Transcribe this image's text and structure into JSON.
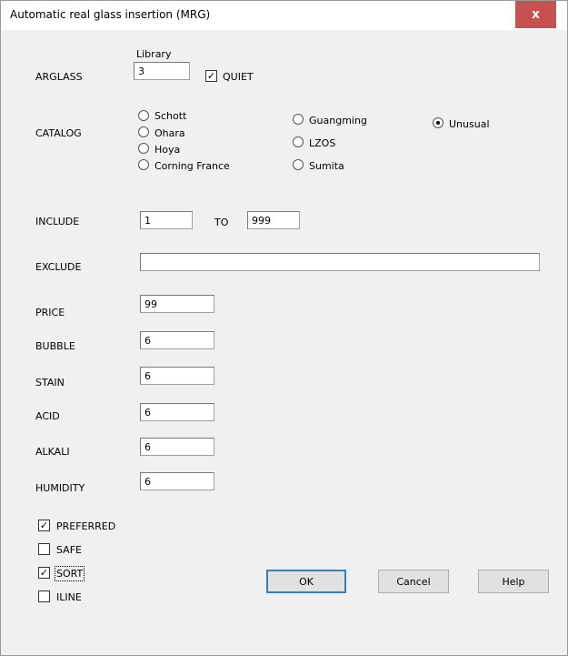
{
  "window": {
    "title": "Automatic real glass insertion (MRG)",
    "close_label": "x"
  },
  "arglass": {
    "label": "ARGLASS",
    "library_label": "Library",
    "value": "3",
    "quiet_label": "QUIET",
    "quiet_checked": true
  },
  "catalog": {
    "label": "CATALOG",
    "options": [
      "Schott",
      "Ohara",
      "Hoya",
      "Corning France",
      "Guangming",
      "LZOS",
      "Sumita",
      "Unusual"
    ],
    "selected": "Unusual"
  },
  "include": {
    "label": "INCLUDE",
    "from": "1",
    "to_label": "TO",
    "to": "999"
  },
  "exclude": {
    "label": "EXCLUDE",
    "value": ""
  },
  "fields": [
    {
      "label": "PRICE",
      "value": "99"
    },
    {
      "label": "BUBBLE",
      "value": "6"
    },
    {
      "label": "STAIN",
      "value": "6"
    },
    {
      "label": "ACID",
      "value": "6"
    },
    {
      "label": "ALKALI",
      "value": "6"
    },
    {
      "label": "HUMIDITY",
      "value": "6"
    }
  ],
  "checks": [
    {
      "label": "PREFERRED",
      "checked": true
    },
    {
      "label": "SAFE",
      "checked": false
    },
    {
      "label": "SORT",
      "checked": true
    },
    {
      "label": "ILINE",
      "checked": false
    }
  ],
  "buttons": {
    "ok": "OK",
    "cancel": "Cancel",
    "help": "Help"
  }
}
